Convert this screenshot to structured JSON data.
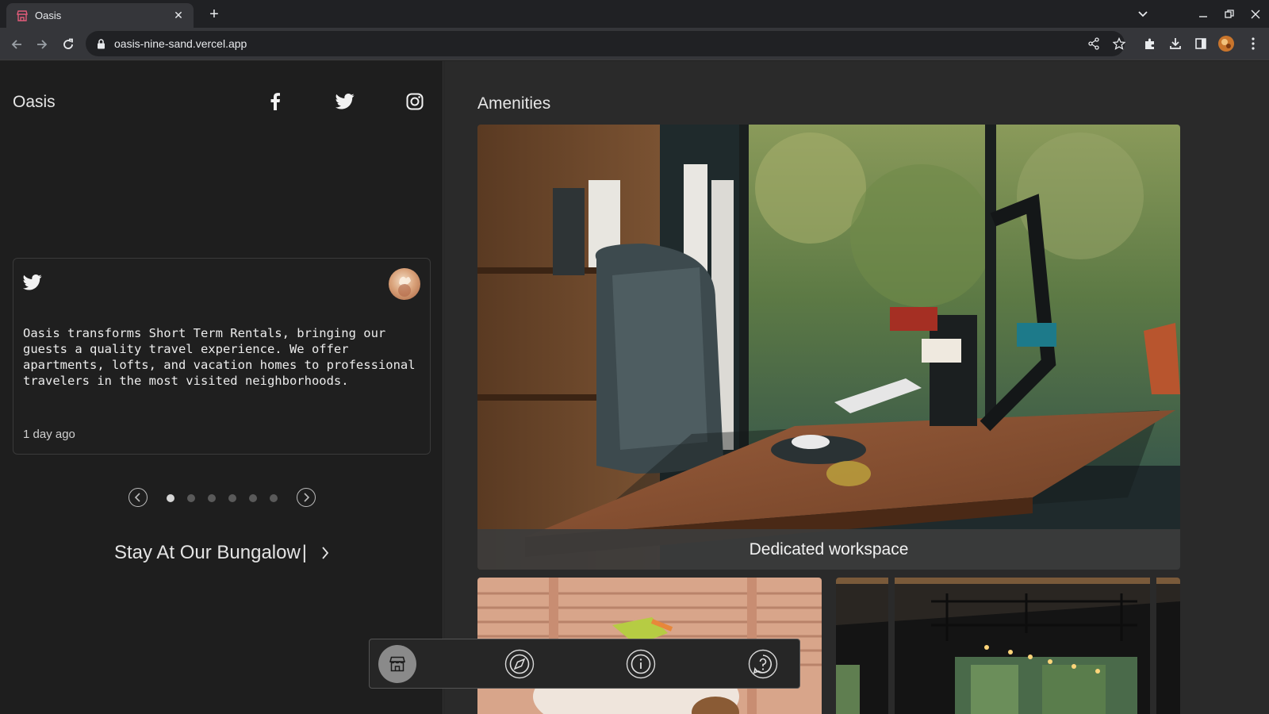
{
  "browser": {
    "tab_title": "Oasis",
    "url": "oasis-nine-sand.vercel.app"
  },
  "sidebar": {
    "brand": "Oasis",
    "social": [
      "facebook-icon",
      "twitter-icon",
      "instagram-icon"
    ],
    "testimonial": {
      "source_icon": "twitter-icon",
      "text": "Oasis transforms Short Term Rentals, bringing our guests a quality travel experience. We offer apartments, lofts, and vacation homes to professional travelers in the most visited neighborhoods.",
      "time": "1 day ago"
    },
    "pager": {
      "total": 6,
      "active": 1
    },
    "cta": {
      "text": "Stay At Our Bungalow",
      "cursor": "|"
    }
  },
  "main": {
    "title": "Amenities",
    "featured_caption": "Dedicated workspace"
  },
  "dock": {
    "items": [
      "store-icon",
      "compass-icon",
      "info-icon",
      "help-icon"
    ],
    "active": 0
  },
  "colors": {
    "sidebar_bg": "#1e1e1e",
    "main_bg": "#2a2a2a",
    "caption_bg": "#3c3c3c",
    "dock_active": "#8a8a8a"
  }
}
